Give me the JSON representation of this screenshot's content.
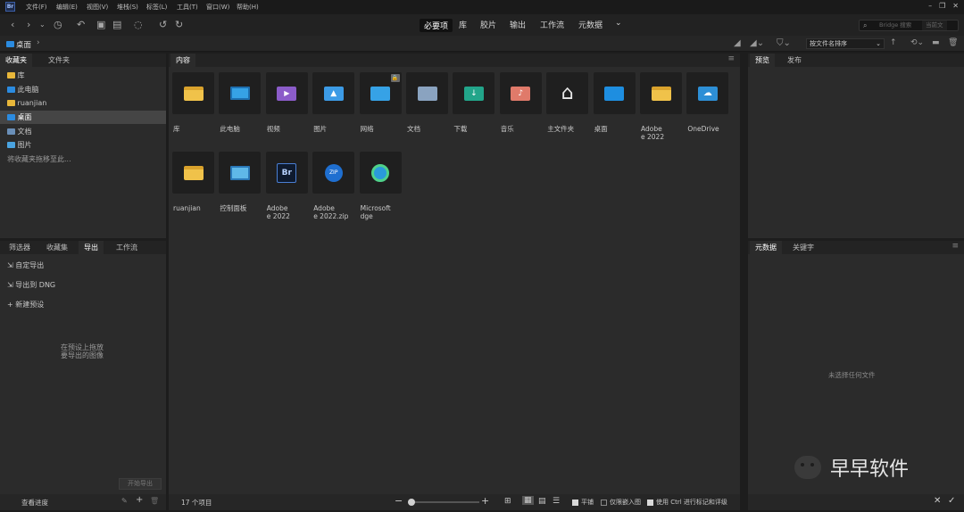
{
  "menu": {
    "items": [
      "文件(F)",
      "编辑(E)",
      "视图(V)",
      "堆栈(S)",
      "标签(L)",
      "工具(T)",
      "窗口(W)",
      "帮助(H)"
    ],
    "app_logo": "Br"
  },
  "workspaces": {
    "active": "必要项",
    "items": [
      "库",
      "胶片",
      "输出",
      "工作流",
      "元数据"
    ]
  },
  "search": {
    "placeholder": "Bridge 搜索",
    "current_folder": "当前文"
  },
  "path": {
    "current": "桌面"
  },
  "sort": {
    "label": "按文件名排序"
  },
  "left_top": {
    "tabs": [
      "收藏夹",
      "文件夹"
    ],
    "favorites": [
      {
        "label": "库",
        "icon": "folder-icon"
      },
      {
        "label": "此电脑",
        "icon": "pc-icon"
      },
      {
        "label": "ruanjian",
        "icon": "folder-icon"
      },
      {
        "label": "桌面",
        "icon": "desktop-icon"
      },
      {
        "label": "文档",
        "icon": "document-icon"
      },
      {
        "label": "图片",
        "icon": "picture-icon"
      }
    ],
    "hint": "将收藏夹拖移至此..."
  },
  "left_bottom": {
    "tabs": [
      "筛选器",
      "收藏集",
      "导出",
      "工作流"
    ],
    "items": [
      "自定导出",
      "导出到 DNG",
      "新建预设"
    ],
    "drop_hint_line1": "在预设上拖放",
    "drop_hint_line2": "要导出的图像",
    "start_button": "开始导出",
    "footer_label": "查看进度"
  },
  "content": {
    "tab": "内容",
    "items": [
      {
        "label": "库",
        "icon": "library-folder-icon"
      },
      {
        "label": "此电脑",
        "icon": "pc-icon"
      },
      {
        "label": "视频",
        "icon": "video-folder-icon"
      },
      {
        "label": "图片",
        "icon": "pictures-folder-icon"
      },
      {
        "label": "网络",
        "icon": "network-icon"
      },
      {
        "label": "文档",
        "icon": "documents-folder-icon"
      },
      {
        "label": "下载",
        "icon": "downloads-folder-icon"
      },
      {
        "label": "音乐",
        "icon": "music-folder-icon"
      },
      {
        "label": "主文件夹",
        "icon": "home-icon"
      },
      {
        "label": "桌面",
        "icon": "desktop-folder-icon"
      },
      {
        "label": "Adobe\ne 2022",
        "icon": "folder-icon"
      },
      {
        "label": "OneDrive",
        "icon": "onedrive-icon"
      },
      {
        "label": "ruanjian",
        "icon": "folder-icon"
      },
      {
        "label": "控制面板",
        "icon": "control-panel-icon"
      },
      {
        "label": "Adobe\ne 2022",
        "icon": "bridge-shortcut-icon"
      },
      {
        "label": "Adobe\ne 2022.zip",
        "icon": "zip-icon"
      },
      {
        "label": "Microsoft\ndge",
        "icon": "edge-shortcut-icon"
      }
    ],
    "status_count": "17 个项目",
    "zoom": 0.05,
    "option_lock_thumbs": "平铺",
    "option_embedded": "仅限嵌入图",
    "option_ctrl": "使用 Ctrl 进行标记和评级"
  },
  "right_top": {
    "tabs": [
      "预览",
      "发布"
    ]
  },
  "right_bottom": {
    "tabs": [
      "元数据",
      "关键字"
    ],
    "empty": "未选择任何文件"
  },
  "watermark": {
    "text": "早早软件"
  }
}
